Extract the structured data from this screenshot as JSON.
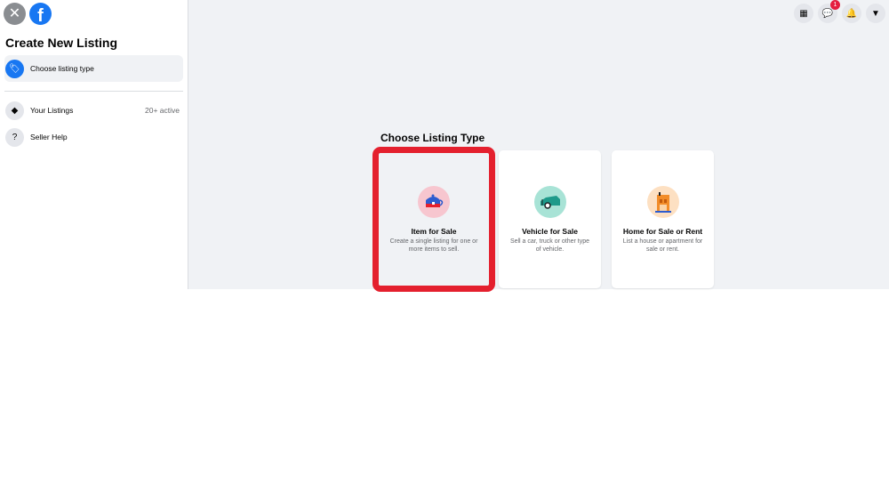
{
  "sidebar": {
    "title": "Create New Listing",
    "items": [
      {
        "label": "Choose listing type",
        "icon": "tag-icon"
      },
      {
        "label": "Your Listings",
        "meta": "20+ active",
        "icon": "tags-icon"
      },
      {
        "label": "Seller Help",
        "icon": "help-icon"
      }
    ]
  },
  "header": {
    "notification_count": "1"
  },
  "main": {
    "section_title": "Choose Listing Type",
    "cards": [
      {
        "title": "Item for Sale",
        "desc": "Create a single listing for one or more items to sell.",
        "selected": true
      },
      {
        "title": "Vehicle for Sale",
        "desc": "Sell a car, truck or other type of vehicle."
      },
      {
        "title": "Home for Sale or Rent",
        "desc": "List a house or apartment for sale or rent."
      }
    ]
  },
  "colors": {
    "accent": "#1877f2",
    "highlight": "#e4202e",
    "background": "#f0f2f5"
  }
}
